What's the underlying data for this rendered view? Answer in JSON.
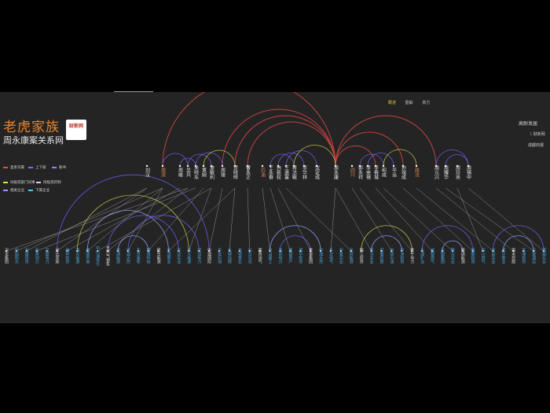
{
  "brand": {
    "title": "老虎家族",
    "subtitle": "周永康案关系网",
    "logo_text": "财新网"
  },
  "tabs": [
    {
      "label": "概述",
      "active": true
    },
    {
      "label": "图解",
      "active": false
    },
    {
      "label": "真方",
      "active": false
    }
  ],
  "right_panel": {
    "title": "高耐发届",
    "sub1": "〔 财新网",
    "sub2": "成都商报"
  },
  "legend": [
    {
      "label": "直系亲属",
      "color": "#e05050"
    },
    {
      "label": "上下级",
      "color": "#7070ff"
    },
    {
      "label": "秘书",
      "color": "#8888ff"
    },
    {
      "label": "同级或部门同事",
      "color": "#e0e060"
    },
    {
      "label": "持股或控制",
      "color": "#d0d0ff"
    },
    {
      "label": "相关企业",
      "color": "#9999ff"
    },
    {
      "label": "下属企业",
      "color": "#56c8ff"
    }
  ],
  "diagram": {
    "colors": {
      "family": "#d04545",
      "superior": "#6b5ff0",
      "colleague": "#c9c94a",
      "company": "#9aa0ff",
      "link": "#bdbdbd",
      "top_label": "#e6e6e6",
      "top_label_alt": "#e08a5a",
      "bottom_label": "#4aa3d8",
      "bottom_label_alt": "#d9d9d9"
    },
    "top_nodes": [
      {
        "label": "刘汉",
        "alt": false
      },
      {
        "label": "周滨",
        "alt": true
      },
      {
        "label": "周峰",
        "alt": false
      },
      {
        "label": "吴兵",
        "alt": false
      },
      {
        "label": "米晓东",
        "alt": false
      },
      {
        "label": "黄婉",
        "alt": false
      },
      {
        "label": "詹敏利",
        "alt": false
      },
      {
        "label": "周锋",
        "alt": false
      },
      {
        "label": "贾晓晔",
        "alt": false
      },
      {
        "label": "曹永正",
        "alt": false
      },
      {
        "label": "石油",
        "alt": true
      },
      {
        "label": "王永春",
        "alt": false
      },
      {
        "label": "冉新权",
        "alt": false
      },
      {
        "label": "王道富",
        "alt": false
      },
      {
        "label": "蒋洁敏",
        "alt": false
      },
      {
        "label": "李华林",
        "alt": false
      },
      {
        "label": "沈定成",
        "alt": false
      },
      {
        "label": "周永康",
        "alt": false
      },
      {
        "label": "四川",
        "alt": true
      },
      {
        "label": "郭永祥",
        "alt": false
      },
      {
        "label": "李崇禧",
        "alt": false
      },
      {
        "label": "李春城",
        "alt": false
      },
      {
        "label": "积成",
        "alt": false
      },
      {
        "label": "平泓",
        "alt": false
      },
      {
        "label": "孙瑞成",
        "alt": false
      },
      {
        "label": "政法",
        "alt": true
      },
      {
        "label": "周元兴",
        "alt": false
      },
      {
        "label": "周耀华",
        "alt": false
      },
      {
        "label": "周玲英",
        "alt": false
      },
      {
        "label": "周锡中",
        "alt": false
      }
    ],
    "bottom_labels": [
      "汉龙集团",
      "中旭阳光",
      "宏盛投资",
      "亚美动力",
      "宝盛电力",
      "米氏家族",
      "瑞祥投资",
      "海天能源",
      "鑫德贸易",
      "中石油昆仑",
      "天然气销售",
      "惠通能源",
      "中润天然",
      "北京泰和",
      "博恒科技",
      "民生能源",
      "华润置业",
      "宏达实业",
      "远大能源",
      "双流电力",
      "中盛国际",
      "华信石油",
      "长城钻探",
      "龙城置业",
      "川东石化",
      "西南油气",
      "中冶建工",
      "宜宾电力",
      "国盛房产",
      "润华投资",
      "金泰集团",
      "中海天然",
      "东方电气",
      "华夏实业",
      "天府能源",
      "锦江投资",
      "新华实业",
      "巴蜀控股",
      "中原石油",
      "中洲投资",
      "金牛电力",
      "天成矿业",
      "成都燃气",
      "宏图集团",
      "联众实业",
      "恒通能源",
      "蜀都投资",
      "四川燃气",
      "龙泉实业",
      "成华置业",
      "嘉禾控股",
      "宜城投资",
      "万豪酒店",
      "峨眉实业"
    ]
  }
}
